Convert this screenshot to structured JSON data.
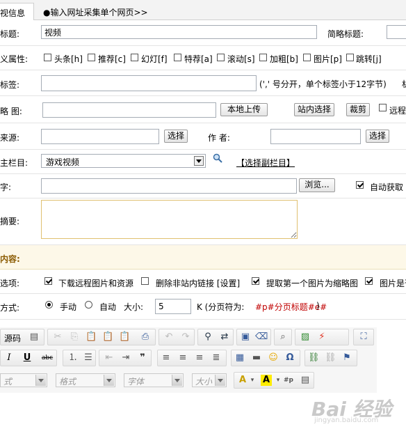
{
  "tabs": [
    {
      "label": "视信息",
      "active": true
    },
    {
      "label": "●输入网址采集单个网页>>",
      "active": false
    }
  ],
  "title_row": {
    "label": "标题:",
    "value": "视频",
    "short_title_label": "简略标题:"
  },
  "attr_row": {
    "label": "义属性:",
    "options": [
      {
        "label": "头条[h]",
        "checked": false
      },
      {
        "label": "推荐[c]",
        "checked": false
      },
      {
        "label": "幻灯[f]",
        "checked": false
      },
      {
        "label": "特荐[a]",
        "checked": false
      },
      {
        "label": "滚动[s]",
        "checked": false
      },
      {
        "label": "加粗[b]",
        "checked": false
      },
      {
        "label": "图片[p]",
        "checked": false
      },
      {
        "label": "跳转[j]",
        "checked": false
      }
    ]
  },
  "tags_row": {
    "label": "标签:",
    "hint": "(',' 号分开，单个标签小于12字节)",
    "extra": "机"
  },
  "thumb_row": {
    "label": "略 图:",
    "upload": "本地上传",
    "site_select": "站内选择",
    "crop": "裁剪",
    "remote": "远程"
  },
  "source_row": {
    "label": "来源:",
    "select1": "选择",
    "author_label": "作 者:",
    "select2": "选择"
  },
  "column_row": {
    "label": "主栏目:",
    "column_value": "游戏视频",
    "sub_column_link": "【选择副栏目】"
  },
  "keyword_row": {
    "label": "字:",
    "browse": "浏览...",
    "auto_get": "自动获取"
  },
  "summary_row": {
    "label": "摘要:"
  },
  "content_header": {
    "label": "内容:"
  },
  "option_row": {
    "label": "选项:",
    "opts": [
      {
        "label": "下载远程图片和资源",
        "checked": true
      },
      {
        "label": "删除非站内链接 [设置]",
        "checked": false
      },
      {
        "label": "提取第一个图片为缩略图",
        "checked": true
      },
      {
        "label": "图片是否",
        "checked": true
      }
    ]
  },
  "paging_row": {
    "label": "方式:",
    "manual": "手动",
    "auto": "自动",
    "size_label": "大小:",
    "size_value": "5",
    "unit": "K (分页符为:",
    "sep": "#p#分页标题#e#",
    "close": ")"
  },
  "editor": {
    "source_label": "源码",
    "style_placeholder": "式",
    "format_placeholder": "格式",
    "font_placeholder": "字体",
    "size_placeholder": "大小"
  },
  "watermark": {
    "text": "Bai 经验",
    "url": "jingyan.baidu.com"
  }
}
